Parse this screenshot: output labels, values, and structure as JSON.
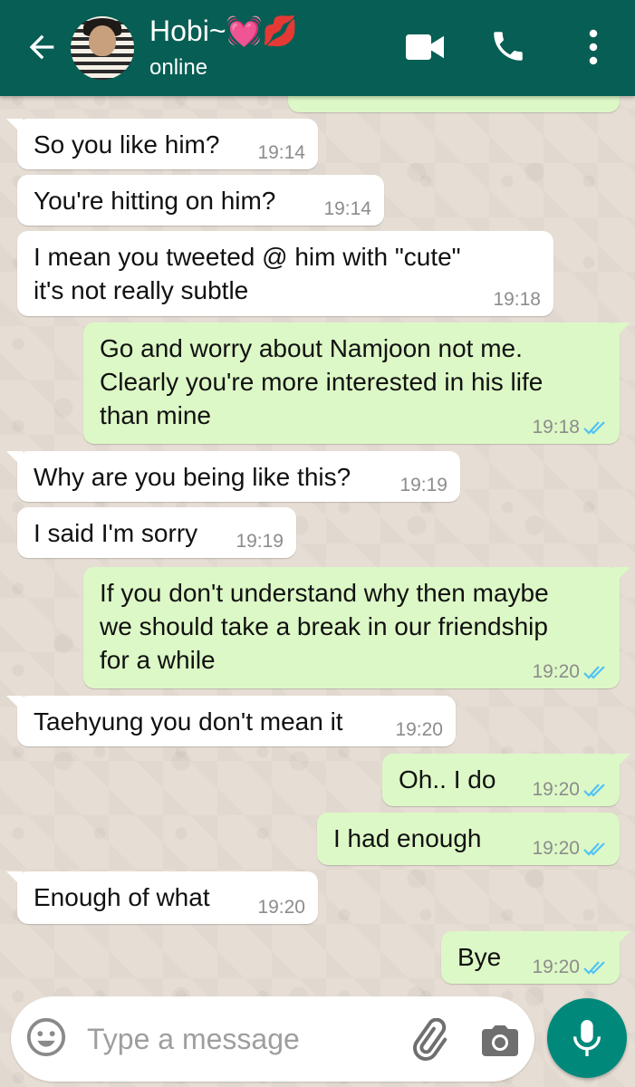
{
  "header": {
    "contact_name": "Hobi~💓💋",
    "status": "online"
  },
  "colors": {
    "header": "#075e54",
    "incoming_bubble": "#ffffff",
    "outgoing_bubble": "#dcf8c6",
    "read_ticks": "#4fc3f7",
    "mic_button": "#00897b"
  },
  "messages": [
    {
      "direction": "in",
      "text": "So you like him?",
      "time": "19:14"
    },
    {
      "direction": "in",
      "text": "You're hitting on him?",
      "time": "19:14"
    },
    {
      "direction": "in",
      "text": "I mean you tweeted @ him with \"cute\"\nit's not really subtle",
      "time": "19:18"
    },
    {
      "direction": "out",
      "text": "Go and worry about Namjoon not me.\nClearly you're more interested in his life\nthan mine",
      "time": "19:18"
    },
    {
      "direction": "in",
      "text": "Why are you being like this?",
      "time": "19:19"
    },
    {
      "direction": "in",
      "text": "I said I'm sorry",
      "time": "19:19"
    },
    {
      "direction": "out",
      "text": "If you don't understand why then maybe\nwe should take a break in our friendship\nfor a while",
      "time": "19:20"
    },
    {
      "direction": "in",
      "text": "Taehyung you don't mean it",
      "time": "19:20"
    },
    {
      "direction": "out",
      "text": "Oh.. I do",
      "time": "19:20"
    },
    {
      "direction": "out",
      "text": "I had enough",
      "time": "19:20"
    },
    {
      "direction": "in",
      "text": "Enough of what",
      "time": "19:20"
    },
    {
      "direction": "out",
      "text": "Bye",
      "time": "19:20"
    }
  ],
  "input": {
    "placeholder": "Type a message"
  },
  "icons": {
    "back": "arrow-left",
    "video": "video-camera",
    "call": "phone",
    "menu": "three-dots-vertical",
    "emoji": "smiley-face",
    "attach": "paperclip",
    "camera": "camera",
    "mic": "microphone",
    "read_receipt": "double-check"
  }
}
